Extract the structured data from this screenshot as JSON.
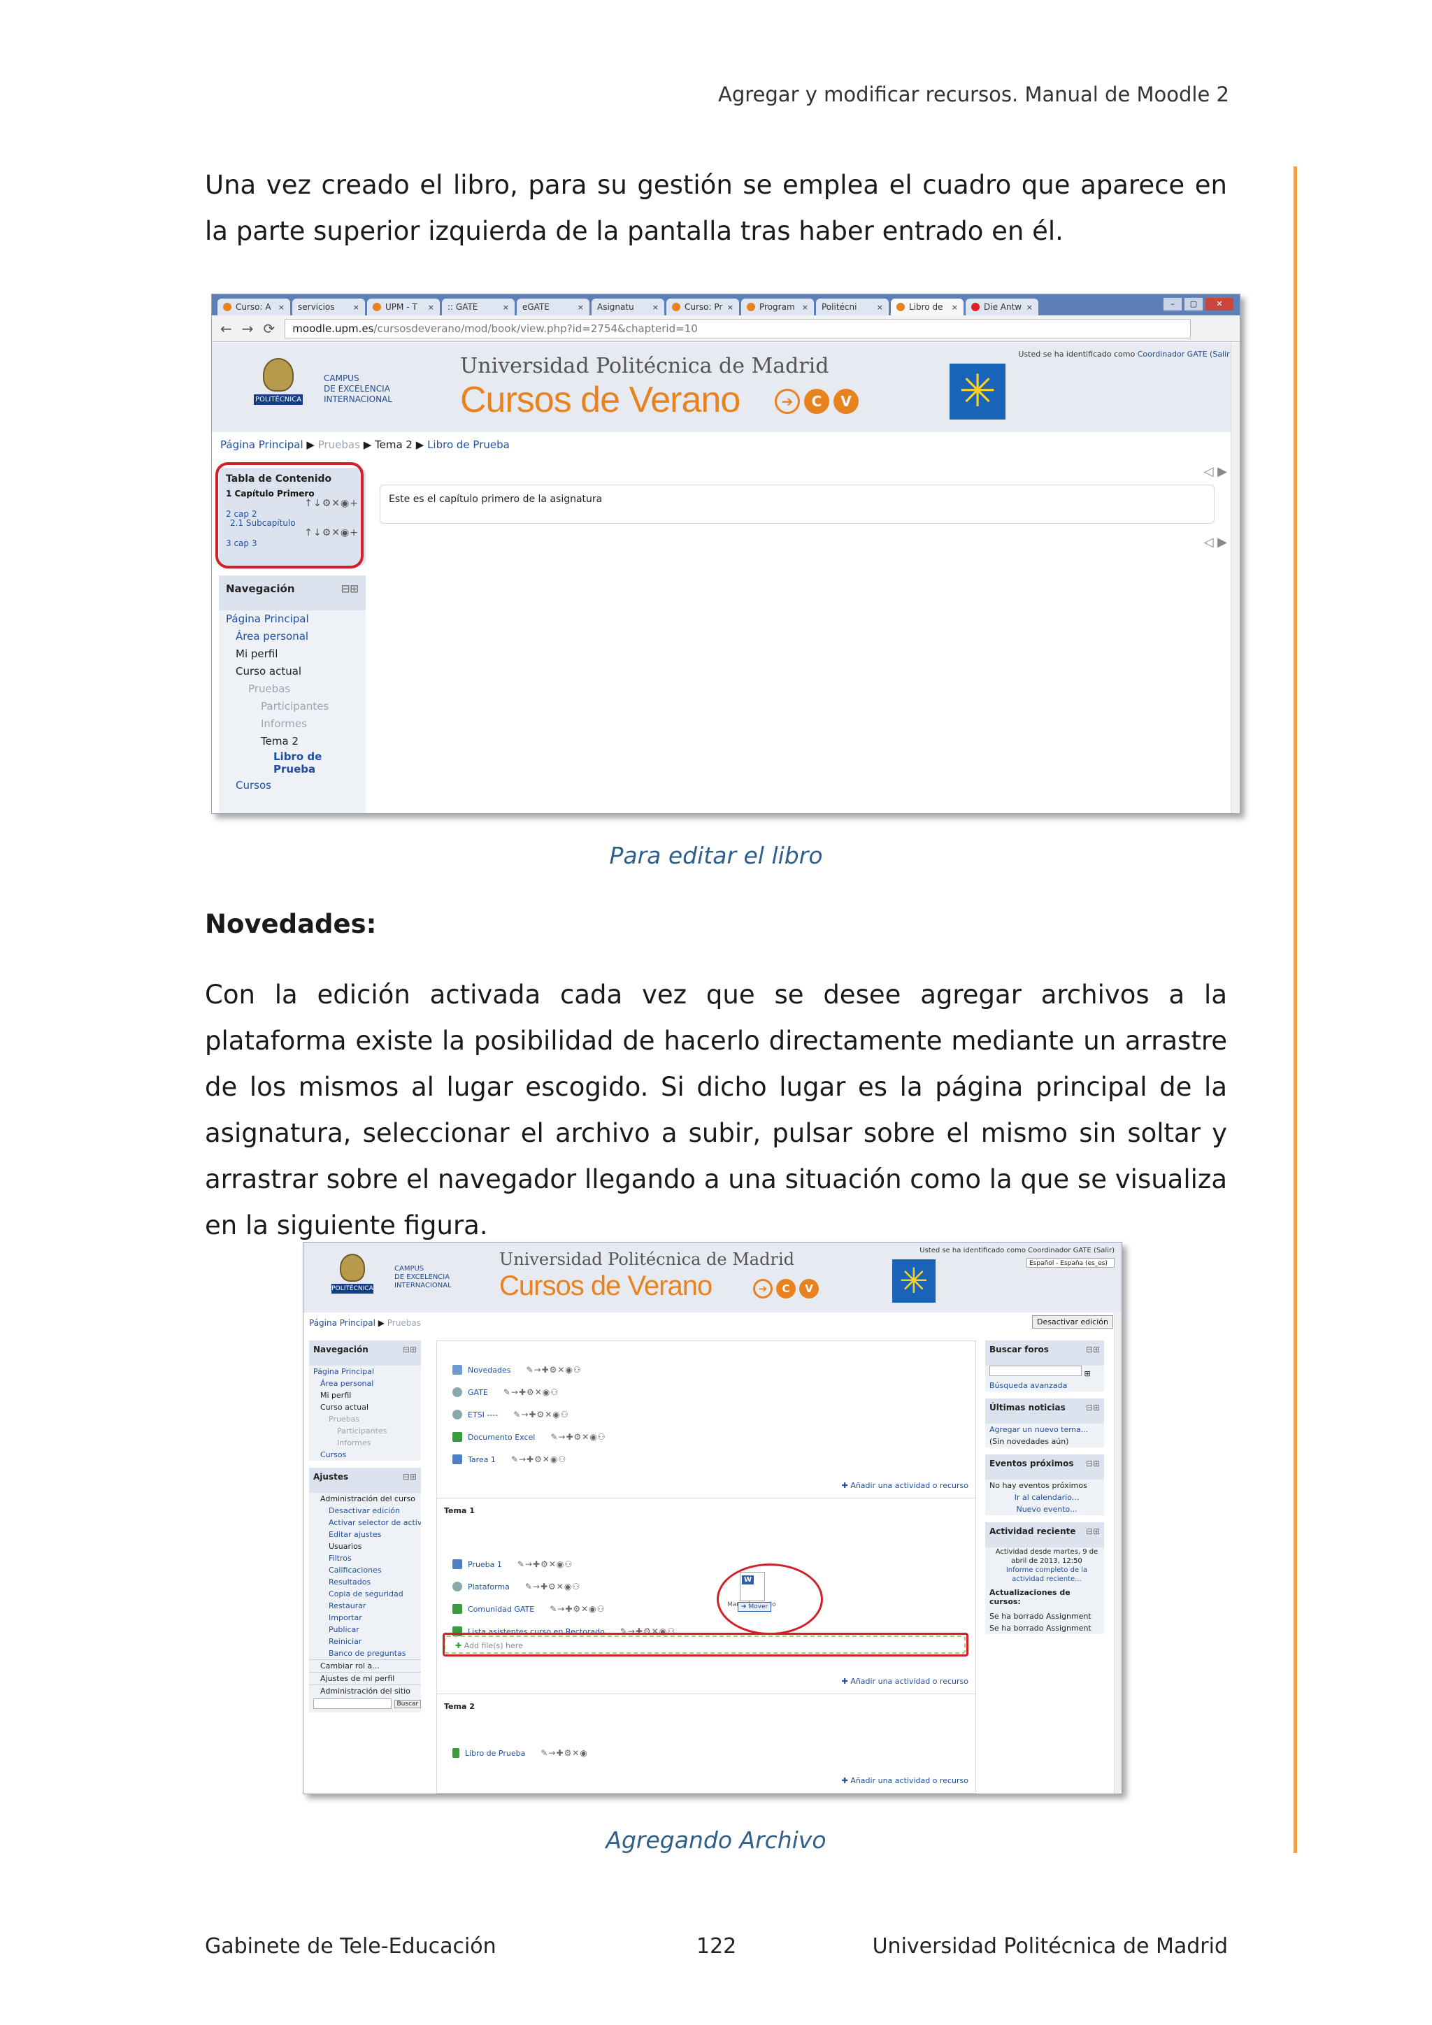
{
  "header": {
    "title": "Agregar y modificar recursos. Manual de Moodle 2"
  },
  "intro": {
    "text": "Una vez creado el libro, para su gestión se emplea el cuadro que aparece en la parte superior izquierda de la pantalla tras haber entrado en él."
  },
  "figure1": {
    "caption": "Para editar el libro",
    "tabs": [
      "Curso: A",
      "servicios",
      "UPM - T",
      ":: GATE",
      "eGATE",
      "Asignatu",
      "Curso: Pr",
      "Program",
      "Politécni",
      "Libro de",
      "Die Antw"
    ],
    "url_host": "moodle.upm.es",
    "url_path": "/cursosdeverano/mod/book/view.php?id=2754&chapterid=10",
    "ident_prefix": "Usted se ha identificado como",
    "ident_user": "Coordinador GATE (Salir)",
    "upm_label": "POLITÉCNICA",
    "campus_lines": [
      "CAMPUS",
      "DE EXCELENCIA",
      "INTERNACIONAL"
    ],
    "university": "Universidad Politécnica de Madrid",
    "brand": "Cursos de Verano",
    "cv_letters": [
      "C",
      "V"
    ],
    "breadcrumb": [
      "Página Principal",
      "Pruebas",
      "Tema 2",
      "Libro de Prueba"
    ],
    "toc": {
      "title": "Tabla de Contenido",
      "items": [
        "1 Capítulo Primero",
        "2 cap 2",
        "2.1 Subcapítulo",
        "3 cap 3"
      ]
    },
    "navigation": {
      "title": "Navegación",
      "items": [
        "Página Principal",
        "Área personal",
        "Mi perfil",
        "Curso actual",
        "Pruebas",
        "Participantes",
        "Informes",
        "Tema 2",
        "Libro de Prueba",
        "Cursos"
      ]
    },
    "content_text": "Este es el capítulo primero de la asignatura"
  },
  "section": {
    "heading": "Novedades:"
  },
  "body": {
    "text": "Con la edición activada cada vez que se desee agregar archivos a la plataforma existe la posibilidad de hacerlo directamente mediante un arrastre de los mismos al lugar escogido. Si dicho lugar es la página principal de la asignatura, seleccionar el archivo a subir, pulsar sobre el mismo sin soltar y arrastrar sobre el navegador llegando a una situación como la que se visualiza en la siguiente figura."
  },
  "figure2": {
    "caption": "Agregando Archivo",
    "ident": "Usted se ha identificado como Coordinador GATE (Salir)",
    "language": "Español - España (es_es)",
    "breadcrumb": [
      "Página Principal",
      "Pruebas"
    ],
    "deactivate_button": "Desactivar edición",
    "navigation": {
      "title": "Navegación",
      "items": [
        "Página Principal",
        "Área personal",
        "Mi perfil",
        "Curso actual",
        "Pruebas",
        "Participantes",
        "Informes",
        "Cursos"
      ]
    },
    "settings": {
      "title": "Ajustes",
      "items": [
        "Administración del curso",
        "Desactivar edición",
        "Activar selector de actividades",
        "Editar ajustes",
        "Usuarios",
        "Filtros",
        "Calificaciones",
        "Resultados",
        "Copia de seguridad",
        "Restaurar",
        "Importar",
        "Publicar",
        "Reiniciar",
        "Banco de preguntas",
        "Cambiar rol a...",
        "Ajustes de mi perfil",
        "Administración del sitio"
      ]
    },
    "search_button": "Buscar",
    "section0_activities": [
      "Novedades",
      "GATE",
      "ETSI ----",
      "Documento Excel",
      "Tarea 1"
    ],
    "add_activity": "Añadir una actividad o recurso",
    "tema1": {
      "title": "Tema 1",
      "activities": [
        "Prueba 1",
        "Plataforma",
        "Comunidad GATE",
        "Lista asistentes curso en Rectorado"
      ]
    },
    "dropzone": "Add file(s) here",
    "drag_file_name": "Manual_cuestio",
    "mover": "Mover",
    "tema2": {
      "title": "Tema 2",
      "activities": [
        "Libro de Prueba"
      ]
    },
    "right_blocks": {
      "forums_title": "Buscar foros",
      "advanced_search": "Búsqueda avanzada",
      "news_title": "Últimas noticias",
      "news_add": "Agregar un nuevo tema...",
      "news_none": "(Sin novedades aún)",
      "events_title": "Eventos próximos",
      "events_none": "No hay eventos próximos",
      "events_calendar": "Ir al calendario...",
      "events_new": "Nuevo evento...",
      "recent_title": "Actividad reciente",
      "recent_since": "Actividad desde martes, 9 de abril de 2013, 12:50",
      "recent_report": "Informe completo de la actividad reciente...",
      "updates_title": "Actualizaciones de cursos:",
      "updates": [
        "Se ha borrado Assignment",
        "Se ha borrado Assignment"
      ]
    }
  },
  "footer": {
    "left": "Gabinete de Tele-Educación",
    "center": "122",
    "right": "Universidad Politécnica de Madrid"
  }
}
